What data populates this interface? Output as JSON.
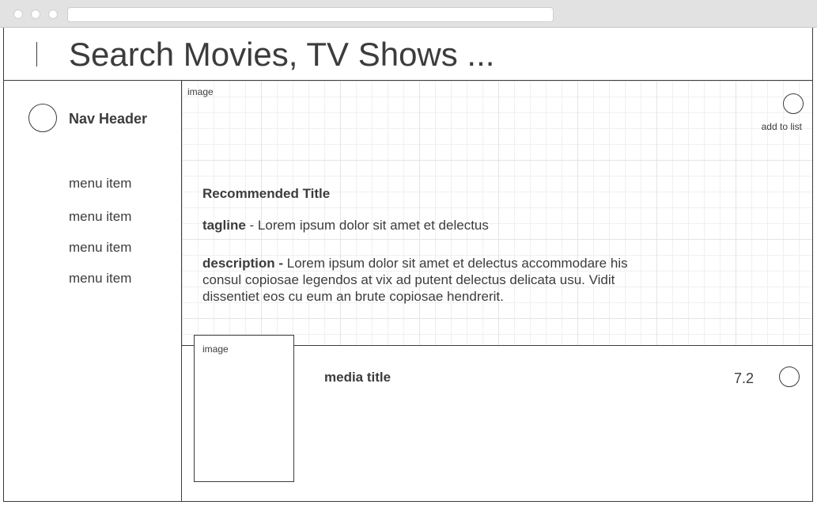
{
  "search": {
    "placeholder": "Search Movies, TV Shows ..."
  },
  "sidebar": {
    "header": "Nav Header",
    "items": [
      {
        "label": "menu item"
      },
      {
        "label": "menu item"
      },
      {
        "label": "menu item"
      },
      {
        "label": "menu item"
      }
    ]
  },
  "hero": {
    "image_label": "image",
    "add_to_list_label": "add to list",
    "title": "Recommended Title",
    "tagline_key": "tagline",
    "tagline_text": " - Lorem ipsum dolor sit amet et delectus",
    "description_key": "description -",
    "description_text": " Lorem ipsum dolor sit amet et delectus accommodare his consul copiosae legendos at vix ad putent delectus delicata usu. Vidit dissentiet eos cu eum an brute copiosae hendrerit."
  },
  "media": {
    "image_label": "image",
    "title": "media title",
    "rating": "7.2"
  }
}
